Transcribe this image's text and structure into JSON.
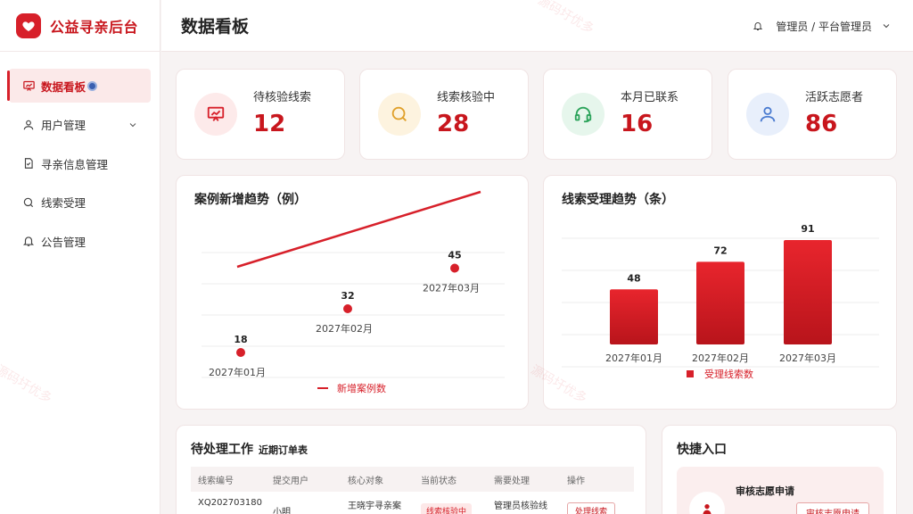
{
  "brand": {
    "title": "公益寻亲后台",
    "accent": "#d7202a"
  },
  "sidebar": {
    "items": [
      {
        "label": "数据看板",
        "icon": "presentation-icon",
        "active": true
      },
      {
        "label": "用户管理",
        "icon": "user-icon",
        "expandable": true
      },
      {
        "label": "寻亲信息管理",
        "icon": "document-check-icon"
      },
      {
        "label": "线索受理",
        "icon": "search-icon"
      },
      {
        "label": "公告管理",
        "icon": "bell-icon"
      }
    ]
  },
  "header": {
    "title": "数据看板",
    "user": "管理员 / 平台管理员"
  },
  "stats": [
    {
      "label": "待核验线索",
      "value": "12",
      "icon": "presentation-icon",
      "color": "#d7202a",
      "bg": "#fdeaea"
    },
    {
      "label": "线索核验中",
      "value": "28",
      "icon": "search-icon",
      "color": "#e0a02a",
      "bg": "#fdf3df"
    },
    {
      "label": "本月已联系",
      "value": "16",
      "icon": "headset-icon",
      "color": "#2ba35a",
      "bg": "#e6f6ec"
    },
    {
      "label": "活跃志愿者",
      "value": "86",
      "icon": "user-icon",
      "color": "#4a7bd0",
      "bg": "#e8effb"
    }
  ],
  "chart_data": [
    {
      "type": "line",
      "title": "案例新增趋势（例）",
      "categories": [
        "2027年01月",
        "2027年02月",
        "2027年03月"
      ],
      "series": [
        {
          "name": "新增案例数",
          "values": [
            18,
            32,
            45
          ]
        }
      ],
      "color": "#d7202a"
    },
    {
      "type": "bar",
      "title": "线索受理趋势（条）",
      "categories": [
        "2027年01月",
        "2027年02月",
        "2027年03月"
      ],
      "series": [
        {
          "name": "受理线索数",
          "values": [
            48,
            72,
            91
          ]
        }
      ],
      "color": "#d7202a"
    }
  ],
  "pending": {
    "title": "待处理工作",
    "subtitle": "近期订单表",
    "columns": [
      "线索编号",
      "提交用户",
      "核心对象",
      "当前状态",
      "需要处理",
      "操作"
    ],
    "rows": [
      {
        "id": "XQ202703180",
        "user": "小明",
        "target": "王晓宇寻亲案",
        "status": "线索核验中",
        "todo": "管理员核验线",
        "action": "处理线索"
      }
    ]
  },
  "quick": {
    "title": "快捷入口",
    "item_label": "审核志愿申请",
    "button": "审核志愿申请"
  },
  "watermark": "源码圩优多"
}
